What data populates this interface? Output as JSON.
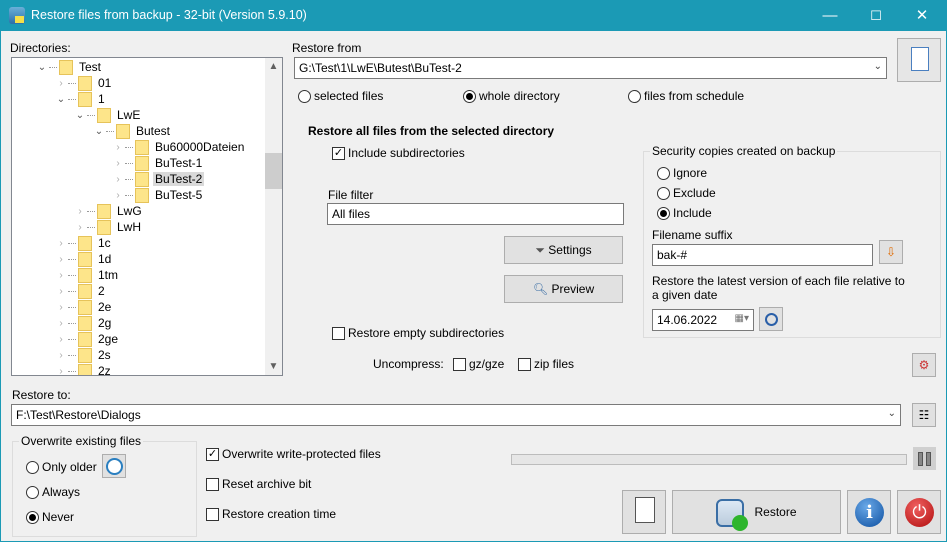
{
  "window": {
    "title": "Restore files from backup - 32-bit (Version 5.9.10)",
    "minimize": "—",
    "maximize": "☐",
    "close": "✕",
    "title_color": "#1b9ab5"
  },
  "directories": {
    "label": "Directories:",
    "items": [
      {
        "label": "Test",
        "level": 0,
        "state": "expanded"
      },
      {
        "label": "01",
        "level": 1,
        "state": "collapsed"
      },
      {
        "label": "1",
        "level": 1,
        "state": "expanded"
      },
      {
        "label": "LwE",
        "level": 2,
        "state": "expanded"
      },
      {
        "label": "Butest",
        "level": 3,
        "state": "expanded"
      },
      {
        "label": "Bu60000Dateien",
        "level": 4,
        "state": "collapsed"
      },
      {
        "label": "BuTest-1",
        "level": 4,
        "state": "collapsed"
      },
      {
        "label": "BuTest-2",
        "level": 4,
        "state": "collapsed",
        "selected": true
      },
      {
        "label": "BuTest-5",
        "level": 4,
        "state": "collapsed"
      },
      {
        "label": "LwG",
        "level": 2,
        "state": "collapsed"
      },
      {
        "label": "LwH",
        "level": 2,
        "state": "collapsed"
      },
      {
        "label": "1c",
        "level": 1,
        "state": "collapsed"
      },
      {
        "label": "1d",
        "level": 1,
        "state": "collapsed"
      },
      {
        "label": "1tm",
        "level": 1,
        "state": "collapsed"
      },
      {
        "label": "2",
        "level": 1,
        "state": "collapsed"
      },
      {
        "label": "2e",
        "level": 1,
        "state": "collapsed"
      },
      {
        "label": "2g",
        "level": 1,
        "state": "collapsed"
      },
      {
        "label": "2ge",
        "level": 1,
        "state": "collapsed"
      },
      {
        "label": "2s",
        "level": 1,
        "state": "collapsed"
      },
      {
        "label": "2z",
        "level": 1,
        "state": "collapsed"
      }
    ]
  },
  "restore_from": {
    "label": "Restore from",
    "value": "G:\\Test\\1\\LwE\\Butest\\BuTest-2",
    "modes": [
      {
        "label": "selected files",
        "checked": false
      },
      {
        "label": "whole directory",
        "checked": true
      },
      {
        "label": "files from schedule",
        "checked": false
      }
    ]
  },
  "main": {
    "heading": "Restore all files from the selected directory",
    "include_subdirs": "Include subdirectories",
    "include_subdirs_checked": true,
    "file_filter_label": "File filter",
    "file_filter_value": "All files",
    "settings": "Settings",
    "preview": "Preview",
    "restore_empty": "Restore empty subdirectories",
    "restore_empty_checked": false,
    "uncompress_label": "Uncompress:",
    "gz": "gz/gze",
    "zip": "zip files"
  },
  "security": {
    "title": "Security copies created on backup",
    "options": [
      {
        "label": "Ignore",
        "checked": false
      },
      {
        "label": "Exclude",
        "checked": false
      },
      {
        "label": "Include",
        "checked": true
      }
    ],
    "suffix_label": "Filename suffix",
    "suffix_value": "bak-#",
    "date_label": "Restore the latest version of each file relative to a given date",
    "date_value": "14.06.2022"
  },
  "restore_to": {
    "label": "Restore to:",
    "value": "F:\\Test\\Restore\\Dialogs"
  },
  "overwrite": {
    "title": "Overwrite existing files",
    "options": [
      {
        "label": "Only older",
        "checked": false
      },
      {
        "label": "Always",
        "checked": false
      },
      {
        "label": "Never",
        "checked": true
      }
    ]
  },
  "options": {
    "write_protected": "Overwrite write-protected files",
    "write_protected_checked": true,
    "reset_archive": "Reset archive bit",
    "creation_time": "Restore creation time"
  },
  "progress": 0,
  "buttons": {
    "restore": "Restore"
  }
}
